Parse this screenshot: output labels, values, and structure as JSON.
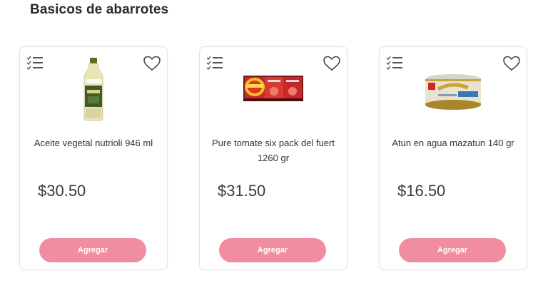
{
  "section": {
    "title": "Basicos de abarrotes"
  },
  "products": [
    {
      "name": "Aceite vegetal nutrioli 946 ml",
      "price": "$30.50",
      "button_label": "Agregar",
      "image_icon": "oil-bottle-image"
    },
    {
      "name": "Pure tomate six pack del fuert 1260 gr",
      "price": "$31.50",
      "button_label": "Agregar",
      "image_icon": "tomato-puree-pack-image"
    },
    {
      "name": "Atun en agua mazatun 140 gr",
      "price": "$16.50",
      "button_label": "Agregar",
      "image_icon": "tuna-can-image"
    }
  ],
  "colors": {
    "accent": "#f08ea0",
    "card_border": "#e3e3e3",
    "text": "#333333"
  }
}
